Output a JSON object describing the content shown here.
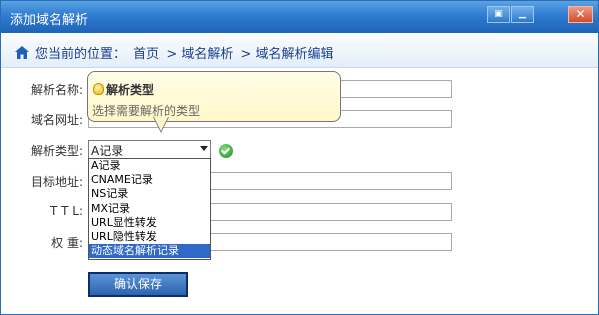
{
  "window": {
    "title": "添加域名解析"
  },
  "titlebar_buttons": {
    "restore_icon": "restore-icon",
    "minimize_icon": "minimize-icon",
    "close_icon": "close-icon"
  },
  "breadcrumb": {
    "prefix": "您当前的位置：",
    "items": [
      "首页",
      "> 域名解析",
      "> 域名解析编辑"
    ]
  },
  "form": {
    "fields": {
      "name_label": "解析名称:",
      "domain_label": "域名网址:",
      "type_label": "解析类型:",
      "target_label": "目标地址:",
      "ttl_label": "T T L:",
      "weight_label": "权 重:"
    },
    "type_select": {
      "value": "A记录",
      "options": [
        "A记录",
        "CNAME记录",
        "NS记录",
        "MX记录",
        "URL显性转发",
        "URL隐性转发",
        "动态域名解析记录"
      ],
      "highlighted": "动态域名解析记录"
    },
    "save_label": "确认保存"
  },
  "tooltip": {
    "title": "解析类型",
    "description": "选择需要解析的类型"
  },
  "colors": {
    "titlebar": "#2f7cd0",
    "accent": "#3169c6",
    "check": "#1d8a1d"
  }
}
